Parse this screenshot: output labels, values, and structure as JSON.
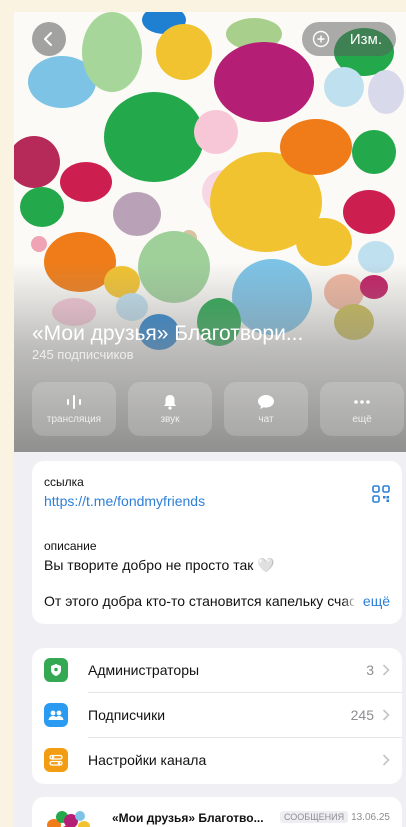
{
  "header": {
    "back_icon": "chevron-left-icon",
    "edit_label": "Изм.",
    "add_emoji_icon": "add-emoji-icon"
  },
  "channel": {
    "title": "«Мои друзья» Благотвори...",
    "subscribers": "245 подписчиков"
  },
  "actions": [
    {
      "label": "трансляция",
      "icon": "broadcast-icon"
    },
    {
      "label": "звук",
      "icon": "bell-icon"
    },
    {
      "label": "чат",
      "icon": "chat-bubble-icon"
    },
    {
      "label": "ещё",
      "icon": "more-dots-icon"
    }
  ],
  "info": {
    "link_label": "ссылка",
    "link_value": "https://t.me/fondmyfriends",
    "qr_icon": "qr-code-icon",
    "description_label": "описание",
    "description_line1": "Вы творите добро не просто так 🤍",
    "description_line2": "От этого добра кто-то становится капельку счастливее",
    "more_label": "ещё"
  },
  "settings": [
    {
      "label": "Администраторы",
      "value": "3",
      "icon": "admin-shield-icon",
      "color": "#34a853"
    },
    {
      "label": "Подписчики",
      "value": "245",
      "icon": "subscribers-icon",
      "color": "#2a9bf0"
    },
    {
      "label": "Настройки канала",
      "value": "",
      "icon": "settings-toggle-icon",
      "color": "#f39c12"
    }
  ],
  "post": {
    "title": "«Мои друзья» Благотво...",
    "badge": "СООБЩЕНИЯ",
    "date": "13.06.25"
  },
  "colors": {
    "accent": "#2d7fd7",
    "page_bg": "#fbf3e1",
    "list_bg": "#efeff4"
  }
}
